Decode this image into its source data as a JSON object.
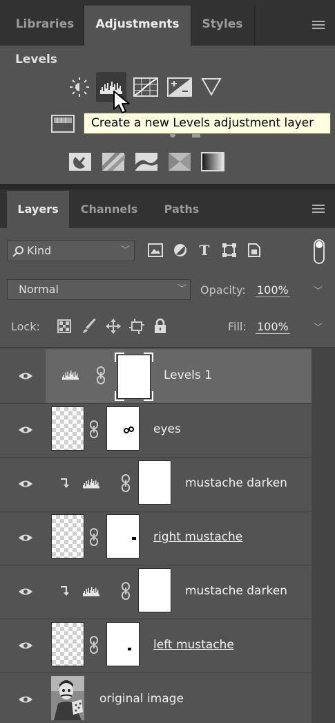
{
  "top_tabs": [
    {
      "label": "Libraries",
      "active": false
    },
    {
      "label": "Adjustments",
      "active": true
    },
    {
      "label": "Styles",
      "active": false
    }
  ],
  "adjustments": {
    "section_title": "Levels",
    "tooltip": "Create a new Levels adjustment layer"
  },
  "layers_tabs": [
    {
      "label": "Layers",
      "active": true
    },
    {
      "label": "Channels",
      "active": false
    },
    {
      "label": "Paths",
      "active": false
    }
  ],
  "filter": {
    "kind_label": "Kind"
  },
  "blend": {
    "mode": "Normal",
    "opacity_label": "Opacity:",
    "opacity_value": "100%"
  },
  "lock": {
    "lock_label": "Lock:",
    "fill_label": "Fill:",
    "fill_value": "100%"
  },
  "layers": [
    {
      "name": "Levels 1",
      "type": "levels",
      "selected": true,
      "clipped": false,
      "underline": false
    },
    {
      "name": "eyes",
      "type": "pixel",
      "selected": false,
      "clipped": false,
      "underline": false
    },
    {
      "name": "mustache darken",
      "type": "levels",
      "selected": false,
      "clipped": true,
      "underline": false
    },
    {
      "name": "right mustache",
      "type": "pixel",
      "selected": false,
      "clipped": false,
      "underline": true
    },
    {
      "name": "mustache darken",
      "type": "levels",
      "selected": false,
      "clipped": true,
      "underline": false
    },
    {
      "name": "left mustache",
      "type": "pixel",
      "selected": false,
      "clipped": false,
      "underline": true
    },
    {
      "name": "original image",
      "type": "photo",
      "selected": false,
      "clipped": false,
      "underline": false
    }
  ],
  "colors": {
    "panel": "#535353",
    "tabbar": "#323232",
    "selected_row": "#676767",
    "tooltip_bg": "#ffffe1"
  }
}
